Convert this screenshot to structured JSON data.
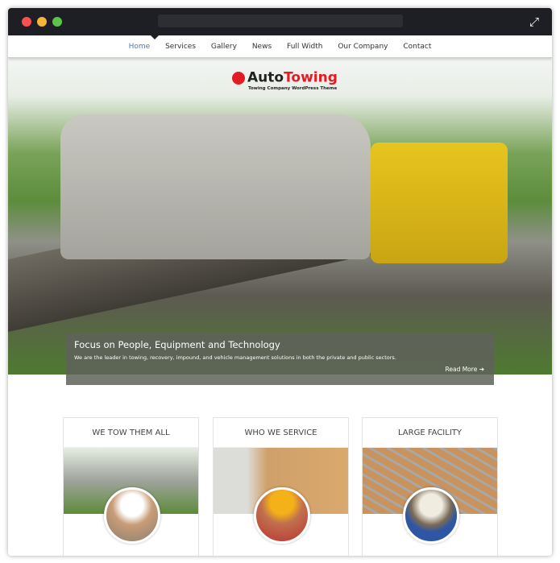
{
  "window": {
    "controls": [
      "close",
      "minimize",
      "maximize"
    ],
    "expand_icon": "expand-arrows-icon"
  },
  "nav": {
    "items": [
      {
        "label": "Home",
        "active": true
      },
      {
        "label": "Services"
      },
      {
        "label": "Gallery"
      },
      {
        "label": "News"
      },
      {
        "label": "Full Width"
      },
      {
        "label": "Our Company"
      },
      {
        "label": "Contact"
      }
    ]
  },
  "logo": {
    "part1": "Auto",
    "part2": "Towing",
    "tagline": "Towing Company WordPress Theme",
    "brand_color": "#e31b23"
  },
  "hero": {
    "title": "Focus on People, Equipment and Technology",
    "text": "We are the leader in towing, recovery, impound, and vehicle management solutions in both the private and public sectors.",
    "read_more": "Read More"
  },
  "cards": [
    {
      "title": "WE TOW THEM ALL"
    },
    {
      "title": "WHO WE SERVICE"
    },
    {
      "title": "LARGE FACILITY"
    }
  ]
}
